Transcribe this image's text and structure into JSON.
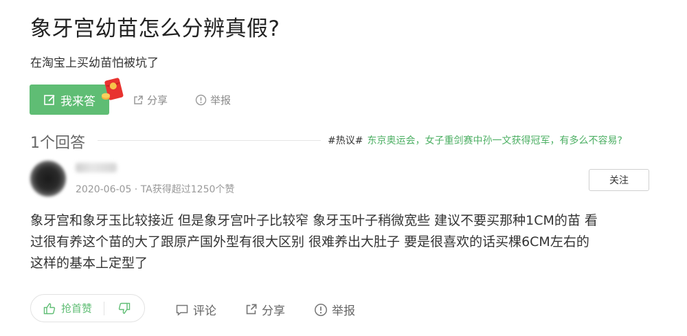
{
  "question": {
    "title": "象牙宫幼苗怎么分辨真假?",
    "description": "在淘宝上买幼苗怕被坑了",
    "answer_button": "我来答",
    "share": "分享",
    "report": "举报"
  },
  "answers_header": {
    "count_label": "1个回答",
    "hot_tag": "#热议#",
    "hot_text": "东京奥运会，女子重剑赛中孙一文获得冠军，有多么不容易?"
  },
  "answer": {
    "meta": "2020-06-05 · TA获得超过1250个赞",
    "follow_label": "关注",
    "content_lines": [
      "象牙宫和象牙玉比较接近 但是象牙宫叶子比较窄 象牙玉叶子稍微宽些 建议不要买那种1CM的苗 看",
      "过很有养这个苗的大了跟原产国外型有很大区别 很难养出大肚子 要是很喜欢的话买棵6CM左右的",
      "这样的基本上定型了"
    ],
    "actions": {
      "upvote": "抢首赞",
      "comment": "评论",
      "share": "分享",
      "report": "举报"
    }
  },
  "colors": {
    "accent": "#5fbd74",
    "link_green": "#4caf63",
    "muted": "#999999"
  },
  "icons": [
    "edit-icon",
    "red-packet-icon",
    "share-icon",
    "report-icon",
    "thumb-up-icon",
    "thumb-down-icon",
    "comment-icon"
  ]
}
